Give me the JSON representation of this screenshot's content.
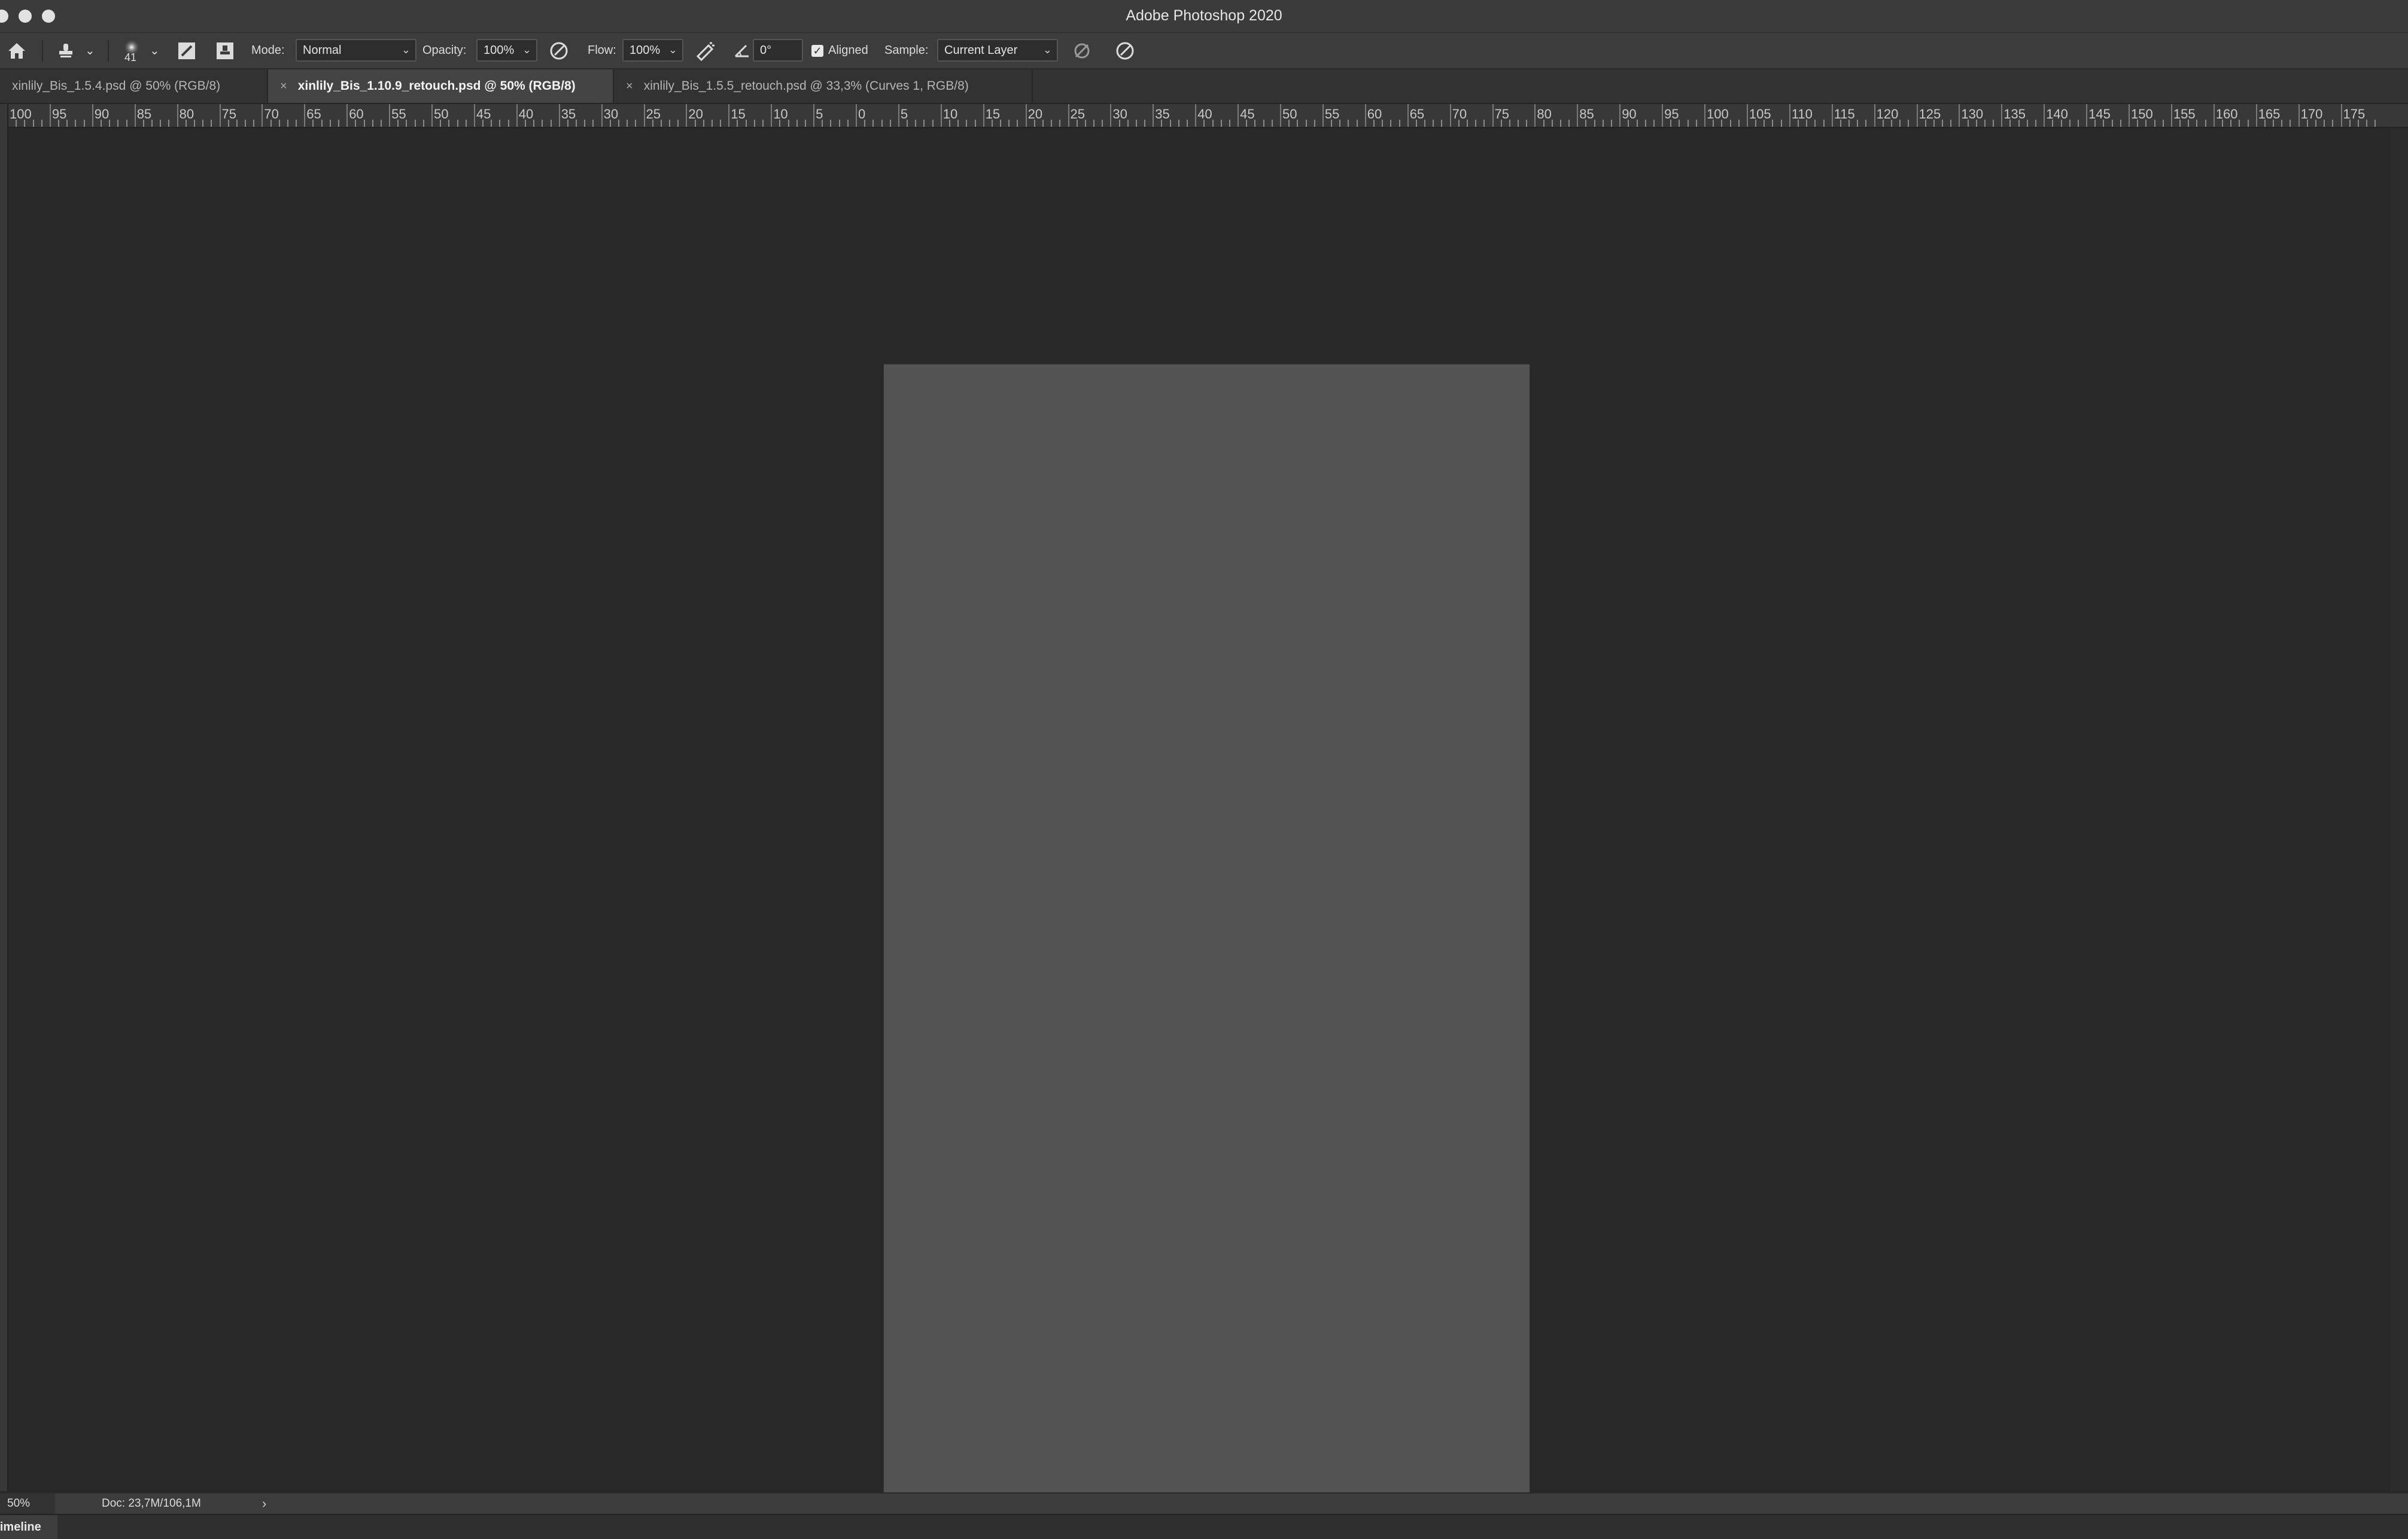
{
  "window": {
    "title": "Adobe Photoshop 2020"
  },
  "options_bar": {
    "brush_size": "41",
    "mode_label": "Mode:",
    "mode_value": "Normal",
    "opacity_label": "Opacity:",
    "opacity_value": "100%",
    "flow_label": "Flow:",
    "flow_value": "100%",
    "angle_value": "0°",
    "aligned_label": "Aligned",
    "aligned_checked": true,
    "sample_label": "Sample:",
    "sample_value": "Current Layer"
  },
  "tabs": [
    {
      "label": "xinlily_Bis_1.5.4.psd @ 50% (RGB/8)",
      "active": false,
      "closable": false
    },
    {
      "label": "xinlily_Bis_1.10.9_retouch.psd @ 50% (RGB/8)",
      "active": true,
      "closable": true
    },
    {
      "label": "xinlily_Bis_1.5.5_retouch.psd @ 33,3% (Curves 1, RGB/8)",
      "active": false,
      "closable": true
    }
  ],
  "ruler": {
    "labels": [
      "100",
      "95",
      "90",
      "85",
      "80",
      "75",
      "70",
      "65",
      "60",
      "55",
      "50",
      "45",
      "40",
      "35",
      "30",
      "25",
      "20",
      "15",
      "10",
      "5",
      "0",
      "5",
      "10",
      "15",
      "20",
      "25",
      "30",
      "35",
      "40",
      "45",
      "50",
      "55",
      "60",
      "65",
      "70",
      "75",
      "80",
      "85",
      "90",
      "95",
      "100",
      "105",
      "110",
      "115",
      "120",
      "125",
      "130",
      "135",
      "140",
      "145",
      "150",
      "155",
      "160",
      "165",
      "170",
      "175"
    ]
  },
  "status_bar": {
    "zoom": "50%",
    "doc_info": "Doc: 23,7M/106,1M",
    "arrow": "›"
  },
  "timeline": {
    "label": "Timeline"
  }
}
